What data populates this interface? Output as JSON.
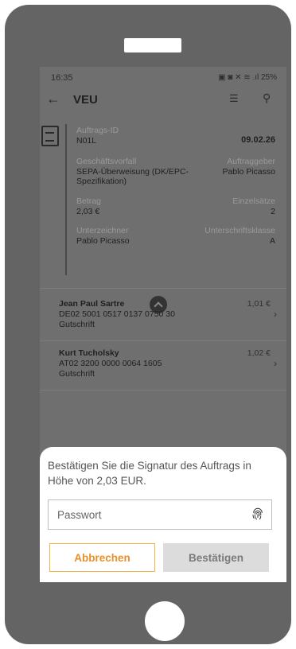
{
  "status_bar": {
    "time": "16:35",
    "indicators": "▣ ◙ ✕ ≋ .ıl 25%"
  },
  "app_bar": {
    "title": "VEU"
  },
  "order": {
    "auftrags_id_label": "Auftrags-ID",
    "auftrags_id": "N01L",
    "date": "09.02.26",
    "geschaeftsvorfall_label": "Geschäftsvorfall",
    "geschaeftsvorfall_line1": "SEPA-Überweisung (DK/EPC-",
    "geschaeftsvorfall_line2": "Spezifikation)",
    "auftraggeber_label": "Auftraggeber",
    "auftraggeber": "Pablo Picasso",
    "betrag_label": "Betrag",
    "betrag": "2,03 €",
    "einzelsaetze_label": "Einzelsätze",
    "einzelsaetze": "2",
    "unterzeichner_label": "Unterzeichner",
    "unterzeichner": "Pablo Picasso",
    "unterschriftsklasse_label": "Unterschriftsklasse",
    "unterschriftsklasse": "A"
  },
  "transactions": [
    {
      "name": "Jean Paul Sartre",
      "iban": "DE02 5001 0517 0137 0750 30",
      "type": "Gutschrift",
      "amount": "1,01 €"
    },
    {
      "name": "Kurt Tucholsky",
      "iban": "AT02 3200 0000 0064 1605",
      "type": "Gutschrift",
      "amount": "1,02 €"
    }
  ],
  "dialog": {
    "message": "Bestätigen Sie die Signatur des Auftrags in Höhe von 2,03 EUR.",
    "password_placeholder": "Passwort",
    "cancel_label": "Abbrechen",
    "confirm_label": "Bestätigen"
  },
  "colors": {
    "accent": "#e8902a",
    "accent_border": "#f2b24c",
    "frame": "#646464",
    "overlay_screen": "#6f6f6f"
  }
}
